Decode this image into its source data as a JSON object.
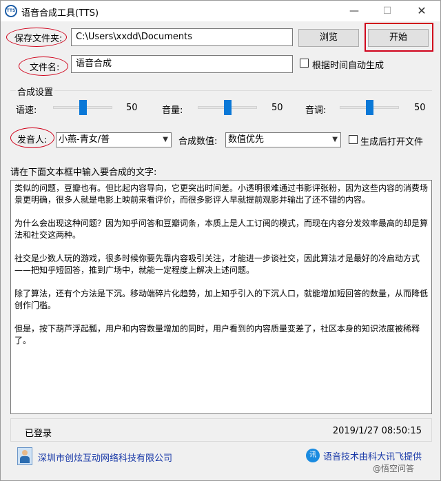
{
  "window": {
    "title": "语音合成工具(TTS)",
    "icon_text": "TTS",
    "minimize_glyph": "—",
    "maximize_glyph": "☐",
    "close_glyph": "✕"
  },
  "folder": {
    "label": "保存文件夹:",
    "value": "C:\\Users\\xxdd\\Documents",
    "browse_label": "浏览",
    "start_label": "开始"
  },
  "filename": {
    "label": "文件名:",
    "value": "语音合成",
    "auto_checkbox_label": "根据时间自动生成",
    "auto_checked": false
  },
  "synth": {
    "group_title": "合成设置",
    "speed": {
      "label": "语速:",
      "value": "50",
      "level": 0.5
    },
    "volume": {
      "label": "音量:",
      "value": "50",
      "level": 0.5
    },
    "pitch": {
      "label": "音调:",
      "value": "50",
      "level": 0.5
    },
    "speaker_label": "发音人:",
    "speaker_value": "小燕-青女/普",
    "value_mode_label": "合成数值:",
    "value_mode": "数值优先",
    "open_after_label": "生成后打开文件",
    "open_after_checked": false
  },
  "text_input": {
    "prompt": "请在下面文本框中输入要合成的文字:",
    "paragraphs": [
      "类似的问题，豆瓣也有。但比起内容导向，它更突出时间差。小透明很难通过书影评张粉，因为这些内容的消费场景更明确，很多人就是电影上映前来看评价，而很多影评人早就提前观影并输出了还不错的内容。",
      "为什么会出现这种问题？因为知乎问答和豆瓣词条，本质上是人工订阅的模式，而现在内容分发效率最高的却是算法和社交这两种。",
      "社交是少数人玩的游戏，很多时候你要先靠内容吸引关注，才能进一步谈社交，因此算法才是最好的冷启动方式——把知乎短回答，推到广场中，就能一定程度上解决上述问题。",
      "除了算法，还有个方法是下沉。移动端碎片化趋势，加上知乎引入的下沉人口，就能增加短回答的数量，从而降低创作门槛。",
      "但是，按下葫芦浮起瓢，用户和内容数量增加的同时，用户看到的内容质量变差了，社区本身的知识浓度被稀释了。"
    ]
  },
  "status": {
    "login": "已登录",
    "datetime": "2019/1/27 08:50:15"
  },
  "footer": {
    "company": "深圳市创炫互动网络科技有限公司",
    "tech": "语音技术由科大讯飞提供",
    "tech_logo_text": "讯"
  },
  "watermark": "@悟空问答",
  "colors": {
    "accent": "#0a78d7",
    "annotation": "#d0021b",
    "link": "#1a3aa8"
  }
}
